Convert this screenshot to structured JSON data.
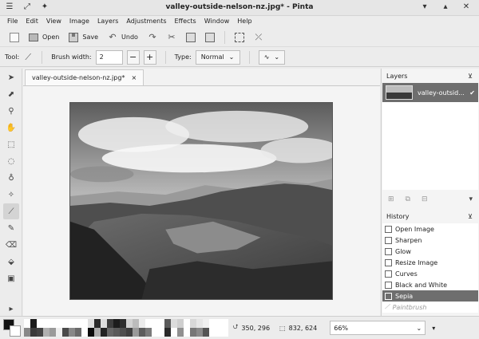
{
  "window": {
    "title": "valley-outside-nelson-nz.jpg* - Pinta"
  },
  "menu": [
    "File",
    "Edit",
    "View",
    "Image",
    "Layers",
    "Adjustments",
    "Effects",
    "Window",
    "Help"
  ],
  "toolbar": {
    "open_label": "Open",
    "save_label": "Save",
    "undo_label": "Undo"
  },
  "options": {
    "tool_label": "Tool:",
    "brush_width_label": "Brush width:",
    "brush_width_value": "2",
    "type_label": "Type:",
    "type_value": "Normal"
  },
  "document": {
    "tab_title": "valley-outside-nelson-nz.jpg*"
  },
  "layers": {
    "header": "Layers",
    "items": [
      {
        "name": "valley-outsid..."
      }
    ]
  },
  "history": {
    "header": "History",
    "items": [
      {
        "label": "Open Image",
        "state": "done"
      },
      {
        "label": "Sharpen",
        "state": "done"
      },
      {
        "label": "Glow",
        "state": "done"
      },
      {
        "label": "Resize Image",
        "state": "done"
      },
      {
        "label": "Curves",
        "state": "done"
      },
      {
        "label": "Black and White",
        "state": "done"
      },
      {
        "label": "Sepia",
        "state": "selected"
      },
      {
        "label": "Paintbrush",
        "state": "undone"
      }
    ]
  },
  "status": {
    "cursor_position": "350, 296",
    "selection_size": "832, 624",
    "zoom": "66%"
  },
  "palette_colors": [
    "#ffffff",
    "#1a1a1a",
    "#ffffff",
    "#ffffff",
    "#ffffff",
    "#ffffff",
    "#ffffff",
    "#ffffff",
    "#ffffff",
    "#ffffff",
    "#e0e0e0",
    "#2a2a2a",
    "#dddddd",
    "#3c3c3c",
    "#1c1c1c",
    "#2e2e2e",
    "#d2d2d2",
    "#bcbcbc",
    "#ececec",
    "#ffffff",
    "#ffffff",
    "#ffffff",
    "#5a5a5a",
    "#dcdcdc",
    "#cfcfcf",
    "#ffffff",
    "#d8d8d8",
    "#e6e6e6",
    "#f0f0f0",
    "#ffffff",
    "#ffffff",
    "#ffffff",
    "#888888",
    "#3a3a3a",
    "#444444",
    "#b0b0b0",
    "#9a9a9a",
    "#eeeeee",
    "#4a4a4a",
    "#888888",
    "#6a6a6a",
    "#ffffff",
    "#0a0a0a",
    "#aaaaaa",
    "#222222",
    "#666666",
    "#5a5a5a",
    "#4e4e4e",
    "#3f3f3f",
    "#999999",
    "#5c5c5c",
    "#7a7a7a",
    "#ffffff",
    "#ffffff",
    "#2a2a2a",
    "#ffffff",
    "#909090",
    "#ffffff",
    "#777777",
    "#8a8a8a",
    "#555555",
    "#ffffff",
    "#ffffff",
    "#ffffff"
  ]
}
